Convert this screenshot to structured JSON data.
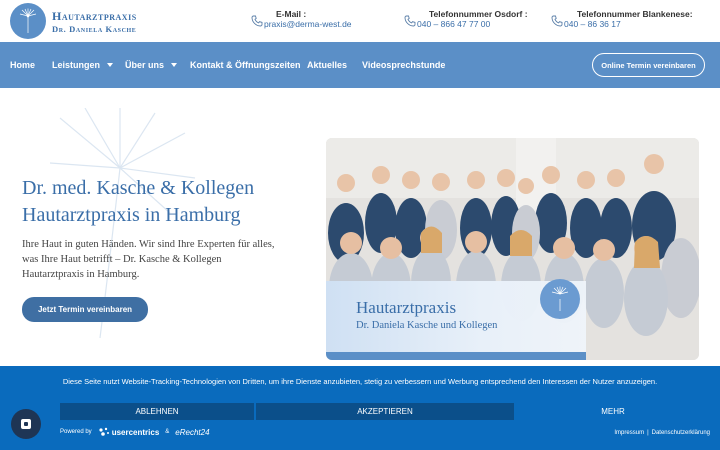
{
  "header": {
    "brand_title": "Hautarztpraxis",
    "brand_subtitle": "Dr. Daniela Kasche",
    "email_label": "E-Mail :",
    "email_value": "praxis@derma-west.de",
    "osdorf_label": "Telefonnummer Osdorf :",
    "osdorf_value": "040 – 866 47 77 00",
    "blankenese_label": "Telefonnummer Blankenese:",
    "blankenese_value": "040 – 86 36 17"
  },
  "nav": {
    "items": [
      {
        "label": "Home"
      },
      {
        "label": "Leistungen"
      },
      {
        "label": "Über uns"
      },
      {
        "label": "Kontakt & Öffnungszeiten"
      },
      {
        "label": "Aktuelles"
      },
      {
        "label": "Videosprechstunde"
      }
    ],
    "cta": "Online Termin vereinbaren"
  },
  "hero": {
    "title_line1": "Dr. med. Kasche & Kollegen",
    "title_line2": "Hautarztpraxis in Hamburg",
    "text": "Ihre Haut in guten Händen. Wir sind Ihre Experten für alles, was Ihre Haut betrifft – Dr. Kasche & Kollegen Hautarztpraxis in Hamburg.",
    "button": "Jetzt Termin vereinbaren"
  },
  "photo": {
    "title": "Hautarztpraxis",
    "subtitle": "Dr. Daniela Kasche und Kollegen"
  },
  "cookie": {
    "text": "Diese Seite nutzt Website-Tracking-Technologien von Dritten, um ihre Dienste anzubieten, stetig zu verbessern und Werbung entsprechend den Interessen der Nutzer anzuzeigen.",
    "reject": "ABLEHNEN",
    "accept": "AKZEPTIEREN",
    "more": "MEHR",
    "powered_by": "Powered by",
    "usercentrics": "usercentrics",
    "amp": "&",
    "erecht": "eRecht24",
    "impressum": "Impressum",
    "separator": "|",
    "datenschutz": "Datenschutzerklärung"
  },
  "colors": {
    "brand_blue": "#5b8fc7",
    "heading_blue": "#3a6ea8",
    "cookie_bg": "#0a6bbd",
    "button_dark": "#0b4f8a"
  }
}
